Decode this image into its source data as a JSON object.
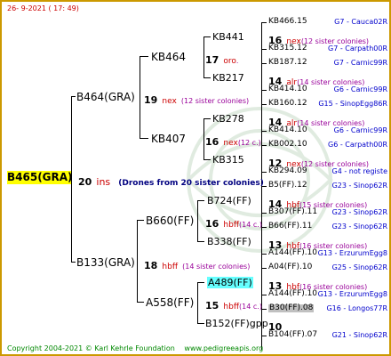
{
  "header": {
    "date": "26-  9-2021  ( 17: 49)"
  },
  "footer": {
    "copyright": "Copyright 2004-2021 © Karl Kehrle Foundation",
    "site": "www.pedigreeapis.org"
  },
  "root": {
    "id": "B465(GRA)",
    "num": "20",
    "race": "ins",
    "note": "(Drones from 20 sister colonies)"
  },
  "gen1": [
    {
      "id": "B464(GRA)",
      "num": "19",
      "race": "nex",
      "sis": "(12 sister colonies)"
    },
    {
      "id": "B133(GRA)",
      "num": "18",
      "race": "hbff",
      "sis": "(14 sister colonies)"
    }
  ],
  "gen2": [
    {
      "id": "KB464",
      "num": "17",
      "race": "oro",
      "sis": "."
    },
    {
      "id": "KB407",
      "num": "16",
      "race": "nex",
      "sis": "(12 c.)"
    },
    {
      "id": "B660(FF)",
      "num": "16",
      "race": "hbff",
      "sis": "(14 c.)"
    },
    {
      "id": "A558(FF)",
      "num": "15",
      "race": "hbff",
      "sis": "(14 c.)"
    }
  ],
  "gen3": [
    {
      "id": "KB441",
      "num": "16",
      "race": "nex",
      "sis": "(12 sister colonies)"
    },
    {
      "id": "KB217",
      "num": "14",
      "race": "alr",
      "sis": "(14 sister colonies)"
    },
    {
      "id": "KB278",
      "num": "14",
      "race": "alr",
      "sis": "(14 sister colonies)"
    },
    {
      "id": "KB315",
      "num": "12",
      "race": "nex",
      "sis": "(12 sister colonies)"
    },
    {
      "id": "B724(FF)",
      "num": "14",
      "race": "hbf",
      "sis": "(15 sister colonies)"
    },
    {
      "id": "B338(FF)",
      "num": "13",
      "race": "hbf",
      "sis": "(16 sister colonies)"
    },
    {
      "id": "A489(FF)",
      "num": "13",
      "race": "hbf",
      "sis": "(16 sister colonies)"
    },
    {
      "id": "B152(FF)gpp",
      "num": "10",
      "race": "",
      "sis": ""
    }
  ],
  "gen4": [
    {
      "id": "KB466.15",
      "lin": "G7 - Cauca02R"
    },
    {
      "id": "KB315.12",
      "lin": "G7 - Carpath00R"
    },
    {
      "id": "KB187.12",
      "lin": "G7 - Carnic99R"
    },
    {
      "id": "KB414.10",
      "lin": "G6 - Carnic99R"
    },
    {
      "id": "KB160.12",
      "lin": "G15 - SinopEgg86R"
    },
    {
      "id": "KB414.10",
      "lin": "G6 - Carnic99R"
    },
    {
      "id": "KB002.10",
      "lin": "G6 - Carpath00R"
    },
    {
      "id": "KB294.09",
      "lin": "G4 - not registe"
    },
    {
      "id": "B5(FF).12",
      "lin": "G23 - Sinop62R"
    },
    {
      "id": "B307(FF).11",
      "lin": "G23 - Sinop62R"
    },
    {
      "id": "B66(FF).11",
      "lin": "G23 - Sinop62R"
    },
    {
      "id": "A144(FF).10",
      "lin": "G13 - ErzurumEgg8"
    },
    {
      "id": "A04(FF).10",
      "lin": "G25 - Sinop62R"
    },
    {
      "id": "A144(FF).10",
      "lin": "G13 - ErzurumEgg8"
    },
    {
      "id": "B30(FF).08",
      "lin": "G16 - Longos77R"
    },
    {
      "id": "B104(FF).07",
      "lin": "G21 - Sinop62R"
    }
  ]
}
